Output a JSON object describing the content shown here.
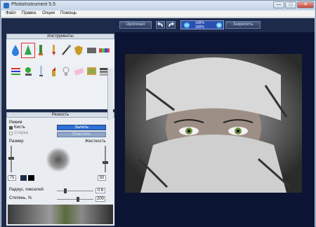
{
  "window": {
    "title": "PhotoInstrument 5.5"
  },
  "window_buttons": {
    "minimize": "—",
    "maximize": "□",
    "close": "✕"
  },
  "menu": [
    "Файл",
    "Правка",
    "Опции",
    "Помощь"
  ],
  "toolbar": {
    "original_label": "Оригинал",
    "zoom_top": "100%",
    "zoom_bottom": "100%",
    "save_label": "Закрепить"
  },
  "panels": {
    "tools_title": "Инструменты",
    "params_title": "Резкость"
  },
  "tools": [
    {
      "icon": "water-drop-icon",
      "selected": false
    },
    {
      "icon": "sharpen-cone-icon",
      "selected": true
    },
    {
      "icon": "tube-icon",
      "selected": false
    },
    {
      "icon": "brush-icon",
      "selected": false
    },
    {
      "icon": "wand-icon",
      "selected": false
    },
    {
      "icon": "shield-icon",
      "selected": false
    },
    {
      "icon": "gradient-icon",
      "selected": false
    },
    {
      "icon": "color-palette-icon",
      "selected": false
    },
    {
      "icon": "stripes-icon",
      "selected": false
    },
    {
      "icon": "clone-stamp-icon",
      "selected": false
    },
    {
      "icon": "syringe-icon",
      "selected": false
    },
    {
      "icon": "lipstick-icon",
      "selected": false
    },
    {
      "icon": "bulb-icon",
      "selected": false
    },
    {
      "icon": "eraser-icon",
      "selected": false
    },
    {
      "icon": "canvas-icon",
      "selected": false
    },
    {
      "icon": "layers-icon",
      "selected": false
    }
  ],
  "params": {
    "mode_label": "Режим",
    "brush_label": "Кисть",
    "eraser_label": "Стерка",
    "fill_button": "Залить",
    "clear_button": "Очистить",
    "size_label": "Размер",
    "hardness_label": "Жесткость",
    "size_value": "75",
    "hardness_value": "50",
    "radius_label": "Радиус, пикселей",
    "radius_value": "0.6",
    "amount_label": "Степень, %",
    "amount_value": "200"
  },
  "colors": {
    "accent": "#2f6fd6",
    "bg_dark": "#1e2a4a",
    "canvas_bg": "#0c1433"
  }
}
